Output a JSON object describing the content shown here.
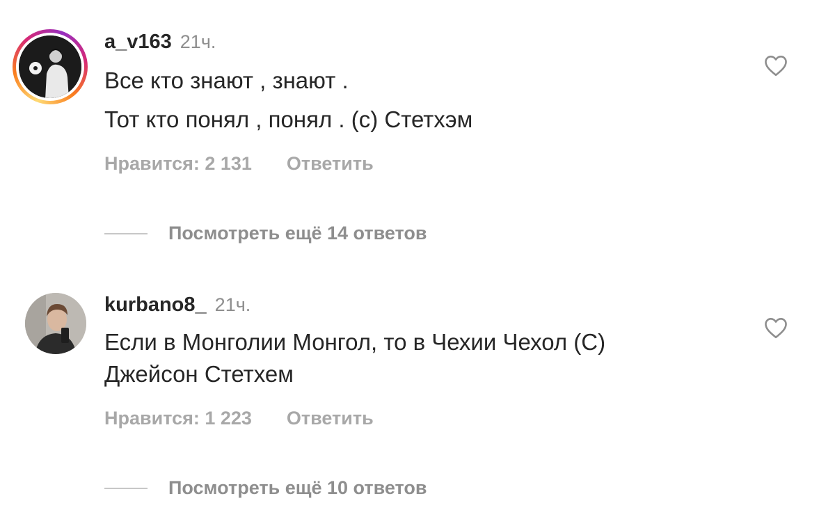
{
  "comments": [
    {
      "username": "a_v163",
      "time": "21ч.",
      "lines": [
        "Все кто знают , знают .",
        "Тот кто понял , понял . (с) Стетхэм"
      ],
      "likes": "Нравится: 2 131",
      "reply": "Ответить",
      "view_replies": "Посмотреть ещё 14 ответов"
    },
    {
      "username": "kurbano8_",
      "time": "21ч.",
      "lines": [
        "Если в Монголии Монгол, то в Чехии Чехол (С)",
        "Джейсон Стетхем"
      ],
      "likes": "Нравится: 1 223",
      "reply": "Ответить",
      "view_replies": "Посмотреть ещё 10 ответов"
    }
  ],
  "icons": {
    "like": "heart-outline-icon",
    "story_ring_colors": [
      "#feda75",
      "#fa7e1e",
      "#d62976",
      "#962fbf"
    ]
  }
}
